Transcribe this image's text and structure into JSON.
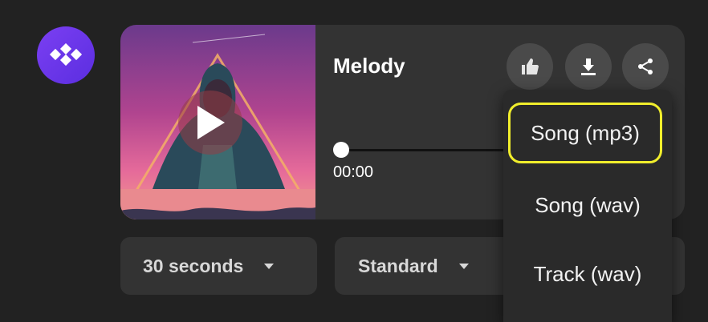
{
  "player": {
    "title": "Melody",
    "time": "00:00",
    "progress": 0
  },
  "icons": {
    "logo": "logo-diamonds-icon",
    "play": "play-icon",
    "like": "thumbs-up-icon",
    "download": "download-icon",
    "share": "share-icon",
    "dropdown": "caret-down-icon"
  },
  "controls": {
    "duration_value": "30 seconds",
    "quality_value": "Standard"
  },
  "download_menu": {
    "items": [
      {
        "label": "Song (mp3)",
        "highlighted": true
      },
      {
        "label": "Song (wav)"
      },
      {
        "label": "Track (wav)"
      }
    ]
  },
  "colors": {
    "background": "#222222",
    "card": "#333333",
    "brand": "#6a35ea",
    "highlight": "#f1ee2c"
  }
}
